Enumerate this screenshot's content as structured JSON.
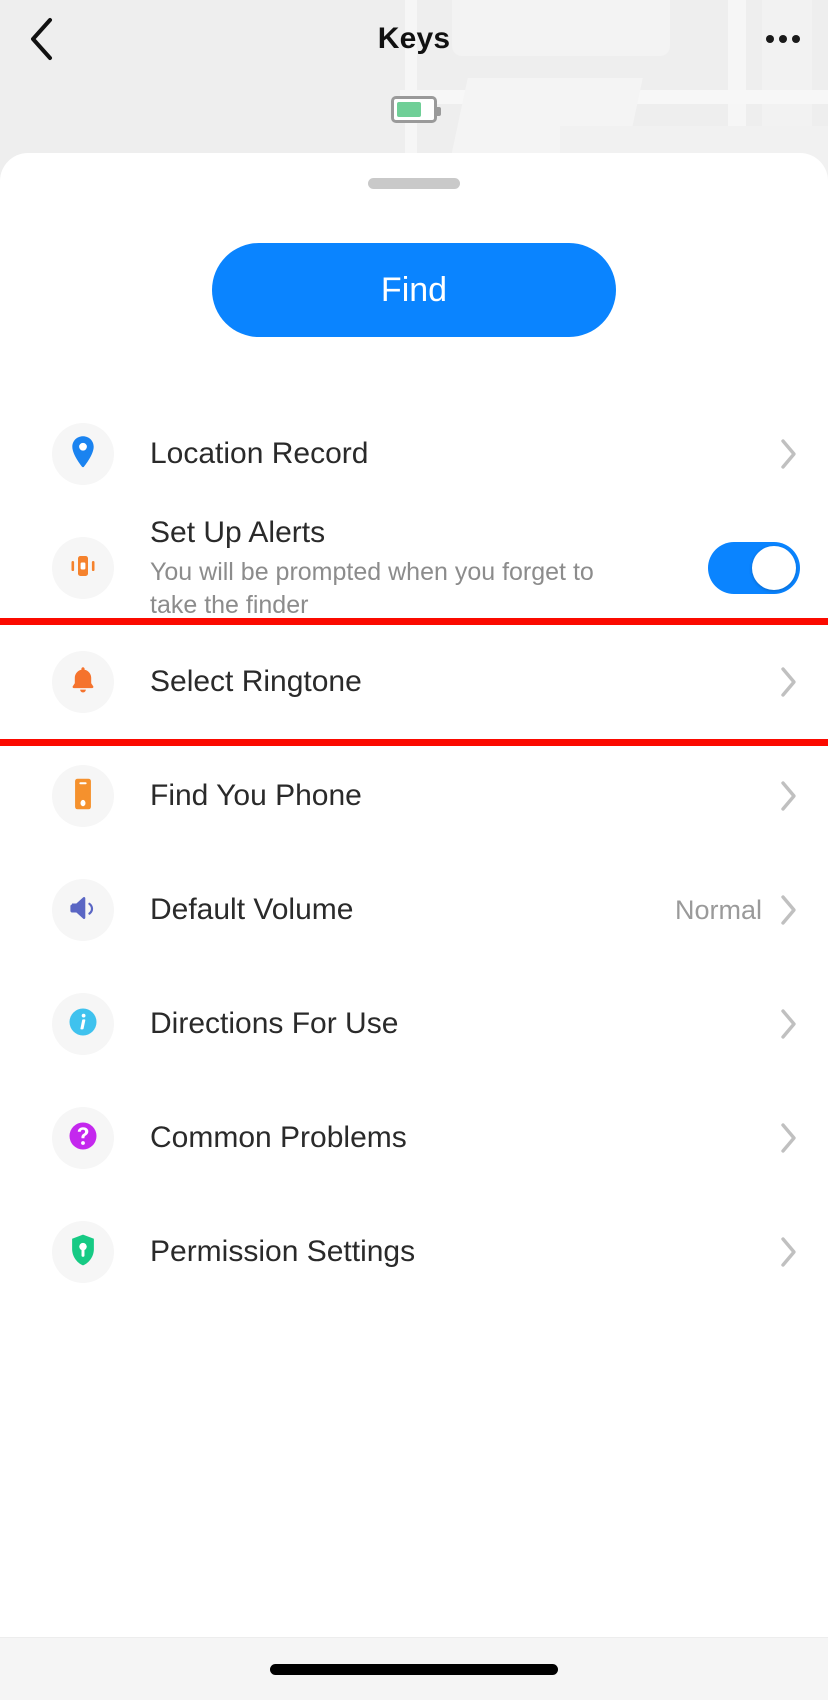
{
  "header": {
    "back_icon": "chevron-left-icon",
    "title": "Keys",
    "more_icon": "more-horizontal-icon"
  },
  "battery": {
    "icon": "battery-icon",
    "level_percent": 72,
    "fill_color": "#6fcf97",
    "outline_color": "#9a9a9a"
  },
  "sheet": {
    "grabber": "drag-handle",
    "find_button": {
      "label": "Find",
      "color": "#0a84ff",
      "text_color": "#ffffff"
    }
  },
  "list": {
    "items": [
      {
        "id": "location-record",
        "title": "Location Record",
        "subtitle": "",
        "icon": "map-pin-icon",
        "icon_color": "#1a83f0",
        "accessory": "chevron",
        "value": "",
        "highlighted": false
      },
      {
        "id": "set-up-alerts",
        "title": "Set Up Alerts",
        "subtitle": "You will be prompted when you forget to take the finder",
        "icon": "vibrate-phone-icon",
        "icon_color": "#f5822d",
        "accessory": "toggle",
        "toggle_on": true,
        "value": "",
        "highlighted": false
      },
      {
        "id": "select-ringtone",
        "title": "Select Ringtone",
        "subtitle": "",
        "icon": "bell-icon",
        "icon_color": "#f5732d",
        "accessory": "chevron",
        "value": "",
        "highlighted": true
      },
      {
        "id": "find-you-phone",
        "title": "Find You Phone",
        "subtitle": "",
        "icon": "mobile-device-icon",
        "icon_color": "#f5912d",
        "accessory": "chevron",
        "value": "",
        "highlighted": false
      },
      {
        "id": "default-volume",
        "title": "Default Volume",
        "subtitle": "",
        "icon": "speaker-volume-icon",
        "icon_color": "#5a66c4",
        "accessory": "chevron",
        "value": "Normal",
        "highlighted": false
      },
      {
        "id": "directions-for-use",
        "title": "Directions For Use",
        "subtitle": "",
        "icon": "info-circle-icon",
        "icon_color": "#3fc2ee",
        "accessory": "chevron",
        "value": "",
        "highlighted": false
      },
      {
        "id": "common-problems",
        "title": "Common Problems",
        "subtitle": "",
        "icon": "question-circle-icon",
        "icon_color": "#c428ee",
        "accessory": "chevron",
        "value": "",
        "highlighted": false
      },
      {
        "id": "permission-settings",
        "title": "Permission Settings",
        "subtitle": "",
        "icon": "shield-key-icon",
        "icon_color": "#16ca84",
        "accessory": "chevron",
        "value": "",
        "highlighted": false
      }
    ]
  },
  "highlight": {
    "color": "#fb0a00",
    "target": "select-ringtone"
  },
  "footer": {
    "home_indicator": "home-indicator"
  }
}
